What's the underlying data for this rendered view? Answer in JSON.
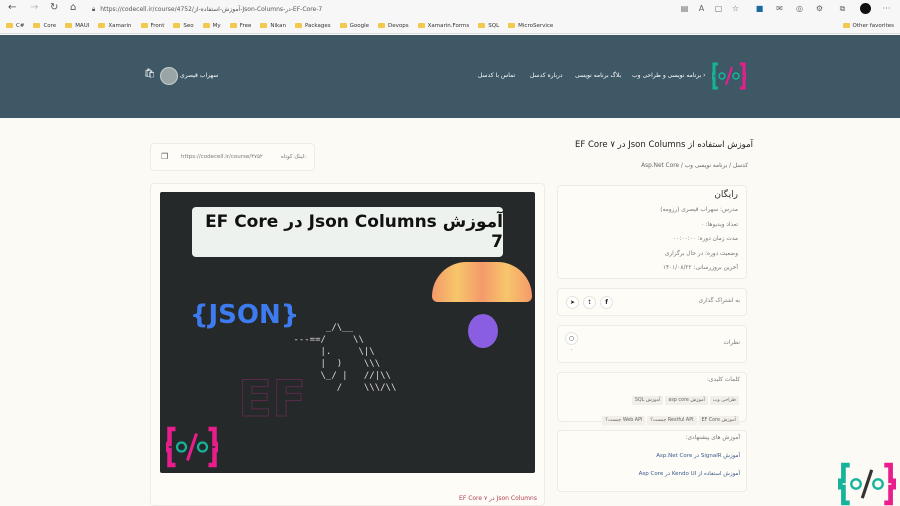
{
  "browser": {
    "url": "https://codecell.ir/course/4752/آموزش-استفاده-از-Json-Columns-در-EF-Core-7",
    "bookmarks": [
      "C#",
      "Core",
      "MAUI",
      "Xamarin",
      "Front",
      "Seo",
      "My",
      "Free",
      "Nikan",
      "Packages",
      "Google",
      "Devops",
      "Xamarin.Forms",
      "SQL",
      "MicroService"
    ],
    "other_favorites": "Other favorites"
  },
  "header": {
    "menu": [
      "برنامه نویسی و طراحی وب",
      "بلاگ برنامه نویسی",
      "درباره کدسل",
      "تماس با کدسل"
    ],
    "user_name": "سهراب قیصری"
  },
  "course": {
    "title": "آموزش استفاده از Json Columns در EF Core ۷",
    "breadcrumb": [
      "کدسل",
      "برنامه نویسی وب",
      "Asp.Net Core"
    ],
    "short_link_label": "لینک کوتاه:",
    "short_link": "https://codecell.ir/course/۴۷۵۲",
    "banner_title": "آموزش Json Columns در EF Core 7",
    "banner_json": "{JSON}",
    "caption": "Json Columns در EF Core ۷"
  },
  "info": {
    "price": "رایگان",
    "lines": [
      "مدرس: سهراب قیصری (رزومه)",
      "تعداد ویدیوها: ۰",
      "مدت زمان دوره: ۰۰:۰۰:۰۰",
      "وضعیت دوره: در حال برگزاری",
      "آخرین بروزرسانی: ۱۴۰۱/۰۸/۲۲"
    ]
  },
  "share": {
    "label": "به اشتراک گذاری"
  },
  "comments": {
    "label": "نظرات",
    "count": "۰"
  },
  "keywords": {
    "label": "کلمات کلیدی:",
    "tags": [
      "طراحی وب",
      "آموزش asp core",
      "آموزش SQL",
      "آموزش EF Core",
      "Restful API چیست؟",
      "Web API چیست؟"
    ]
  },
  "suggested": {
    "label": "آموزش های پیشنهادی:",
    "items": [
      "آموزش SignalR در Asp.Net Core",
      "آموزش استفاده از Kendo UI در Asp Core"
    ]
  },
  "colors": {
    "header": "#3e5866",
    "accent": "#e91e8c",
    "teal": "#16b39a"
  }
}
